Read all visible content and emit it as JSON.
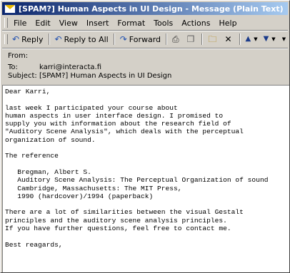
{
  "window": {
    "title": "[SPAM?] Human Aspects in UI Design - Message (Plain Text)"
  },
  "menubar": {
    "items": [
      {
        "label": "File"
      },
      {
        "label": "Edit"
      },
      {
        "label": "View"
      },
      {
        "label": "Insert"
      },
      {
        "label": "Format"
      },
      {
        "label": "Tools"
      },
      {
        "label": "Actions"
      },
      {
        "label": "Help"
      }
    ]
  },
  "toolbar": {
    "reply_label": "Reply",
    "reply_all_label": "Reply to All",
    "forward_label": "Forward"
  },
  "header": {
    "from_label": "From:",
    "from_value": "",
    "to_label": "To:",
    "to_value": "karri@interacta.fi",
    "subject_label": "Subject:",
    "subject_value": "[SPAM?] Human Aspects in UI Design"
  },
  "message": {
    "lines": [
      "Dear Karri,",
      "",
      "last week I participated your course about",
      "human aspects in user interface design. I promised to",
      "supply you with information about the research field of",
      "\"Auditory Scene Analysis\", which deals with the perceptual",
      "organization of sound.",
      "",
      "The reference",
      "",
      "   Bregman, Albert S.",
      "   Auditory Scene Analysis: The Perceptual Organization of sound",
      "   Cambridge, Massachusetts: The MIT Press,",
      "   1990 (hardcover)/1994 (paperback)",
      "",
      "There are a lot of similarities between the visual Gestalt",
      "principles and the auditory scene analysis principles.",
      "If you have further questions, feel free to contact me.",
      "",
      "Best reagards,"
    ]
  }
}
